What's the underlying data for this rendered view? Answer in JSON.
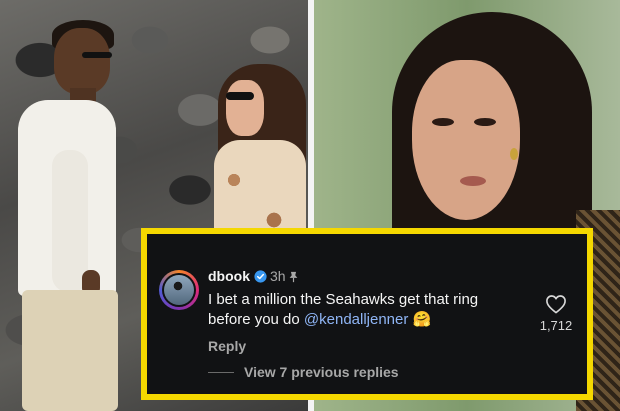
{
  "comment": {
    "username": "dbook",
    "timestamp": "3h",
    "text_before_mention": "I bet a million the Seahawks get that ring before you do ",
    "mention": "@kendalljenner",
    "emoji": "🤗",
    "reply_label": "Reply",
    "like_count": "1,712",
    "view_replies_label": "View 7 previous replies",
    "icons": {
      "verified": "verified-badge-icon",
      "pin": "pin-icon",
      "like": "heart-icon"
    }
  },
  "colors": {
    "highlight_border": "#f5d800",
    "card_background": "#111214",
    "mention": "#8fb5f5",
    "verified_badge": "#3897f0"
  }
}
